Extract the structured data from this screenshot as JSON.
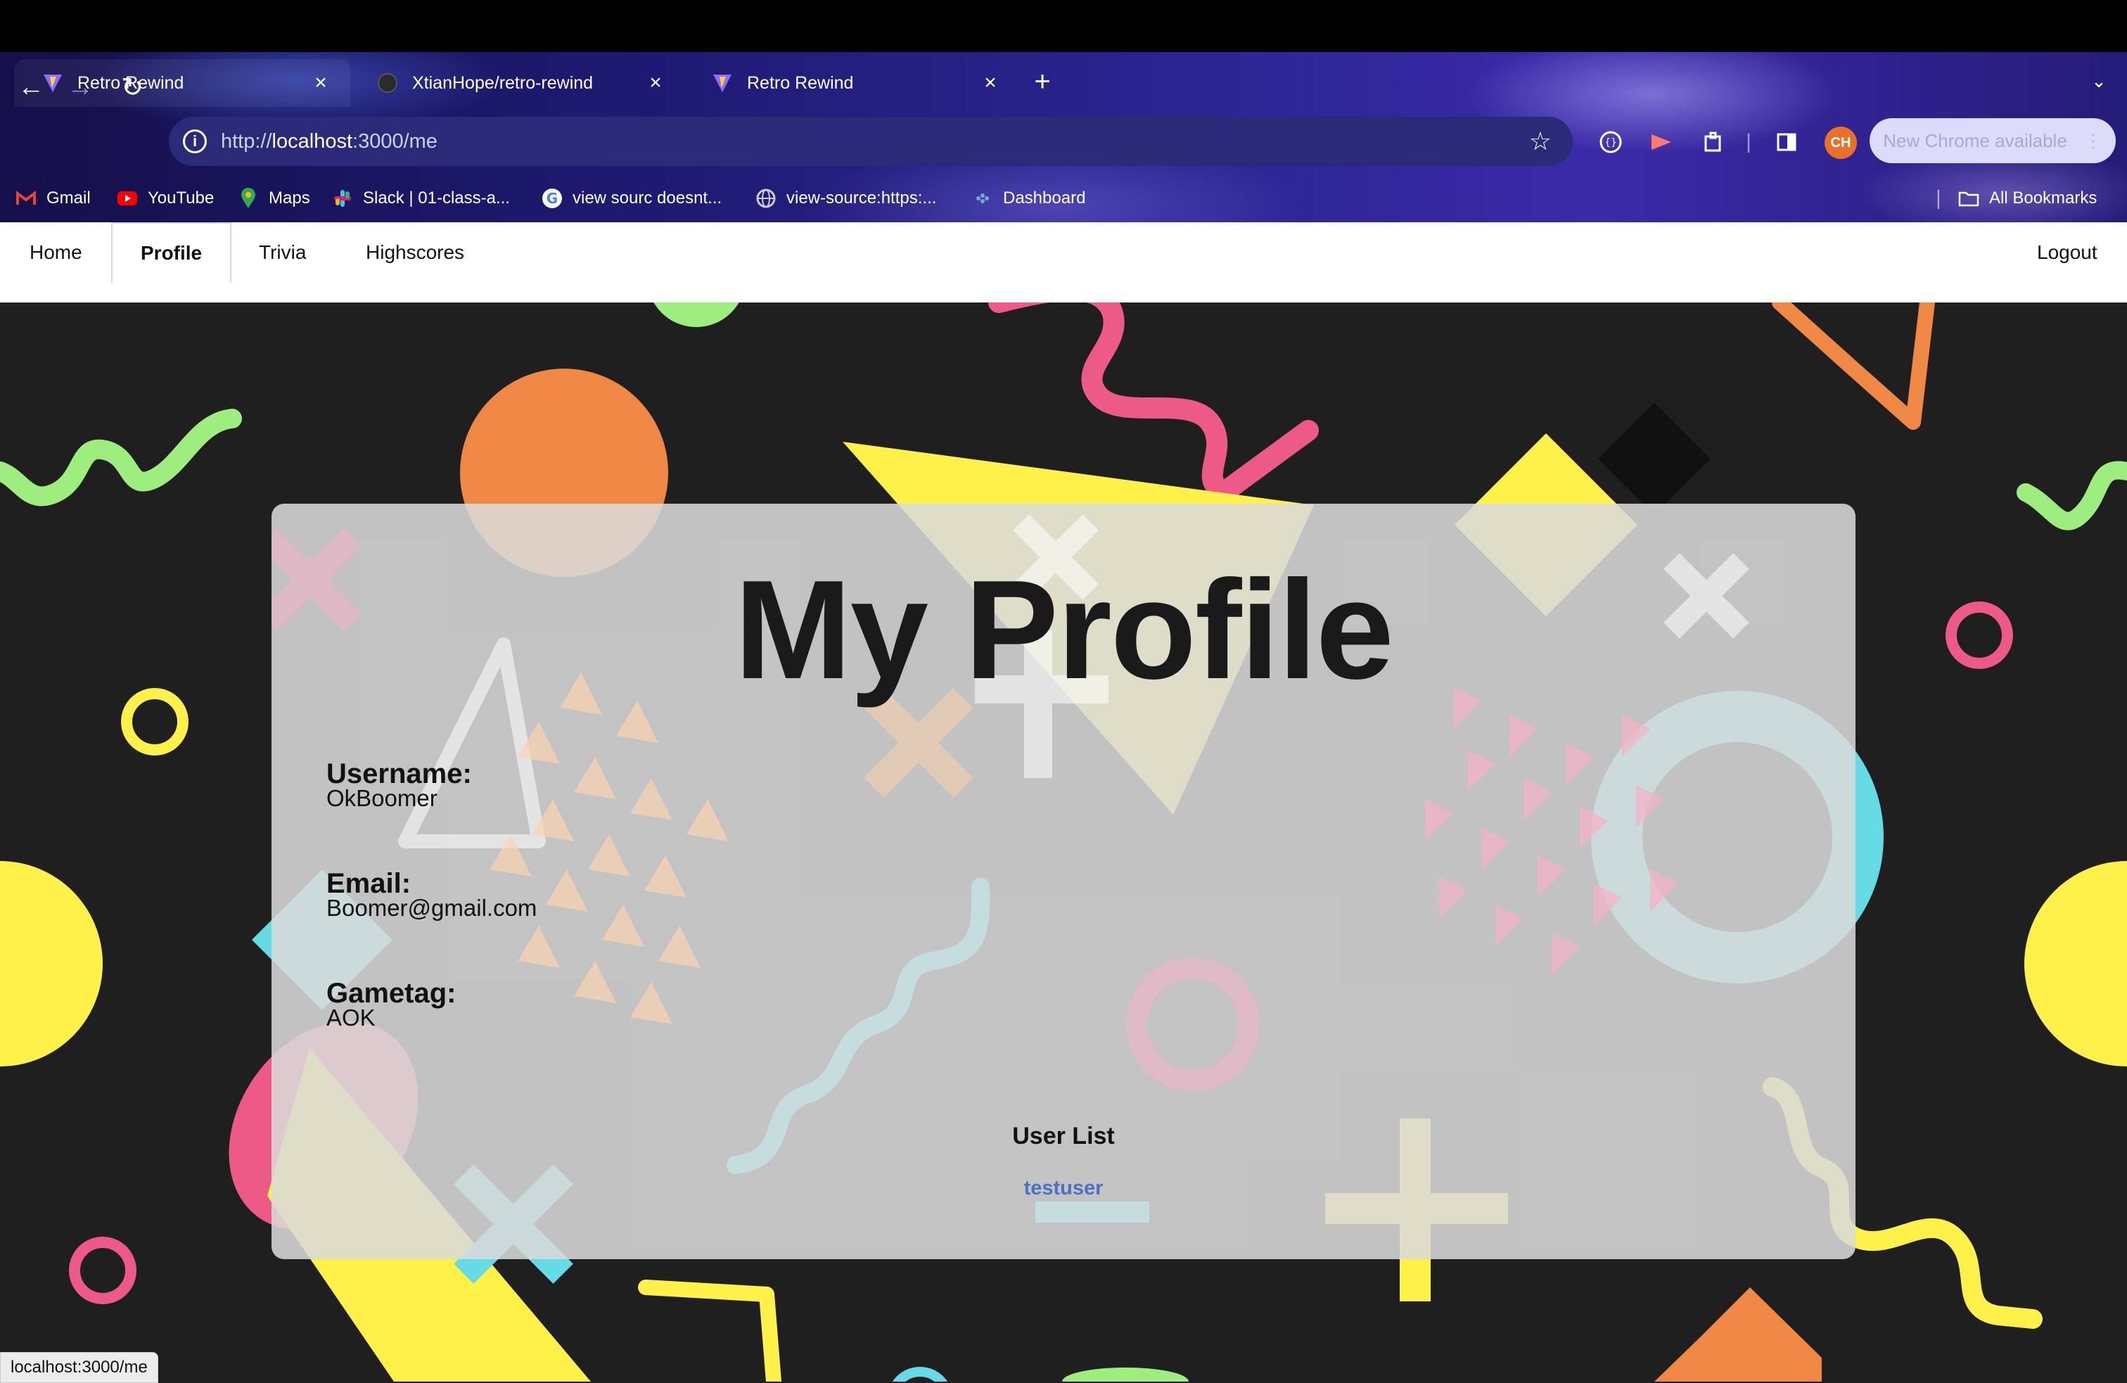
{
  "browser": {
    "tabs": [
      {
        "title": "Retro Rewind",
        "icon": "vite-icon",
        "active": true
      },
      {
        "title": "XtianHope/retro-rewind",
        "icon": "github-icon",
        "active": false
      },
      {
        "title": "Retro Rewind",
        "icon": "vite-icon",
        "active": false
      }
    ],
    "new_tab": "+",
    "url_scheme": "http://",
    "url_host": "localhost",
    "url_path": ":3000/me",
    "profile_initials": "CH",
    "update_button": "New Chrome available",
    "bookmarks": [
      {
        "label": "Gmail",
        "icon": "gmail-icon"
      },
      {
        "label": "YouTube",
        "icon": "youtube-icon"
      },
      {
        "label": "Maps",
        "icon": "maps-icon"
      },
      {
        "label": "Slack | 01-class-a...",
        "icon": "slack-icon"
      },
      {
        "label": "view sourc doesnt...",
        "icon": "google-icon"
      },
      {
        "label": "view-source:https:...",
        "icon": "globe-icon"
      },
      {
        "label": "Dashboard",
        "icon": "dashboard-icon"
      }
    ],
    "all_bookmarks": "All Bookmarks"
  },
  "nav": {
    "home": "Home",
    "profile": "Profile",
    "trivia": "Trivia",
    "highscores": "Highscores",
    "logout": "Logout"
  },
  "profile": {
    "title": "My Profile",
    "username_label": "Username:",
    "username": "OkBoomer",
    "email_label": "Email:",
    "email": "Boomer@gmail.com",
    "gametag_label": "Gametag:",
    "gametag": "AOK",
    "user_list_title": "User List",
    "users": [
      "testuser"
    ]
  },
  "status_bar": "localhost:3000/me",
  "colors": {
    "background": "#1f1f1f",
    "card": "#dadada",
    "link": "#4a72c4",
    "orange": "#ee8844",
    "pink": "#ee5a87",
    "yellow": "#fff04a",
    "green": "#9dee7e",
    "cyan": "#66dbe6"
  }
}
